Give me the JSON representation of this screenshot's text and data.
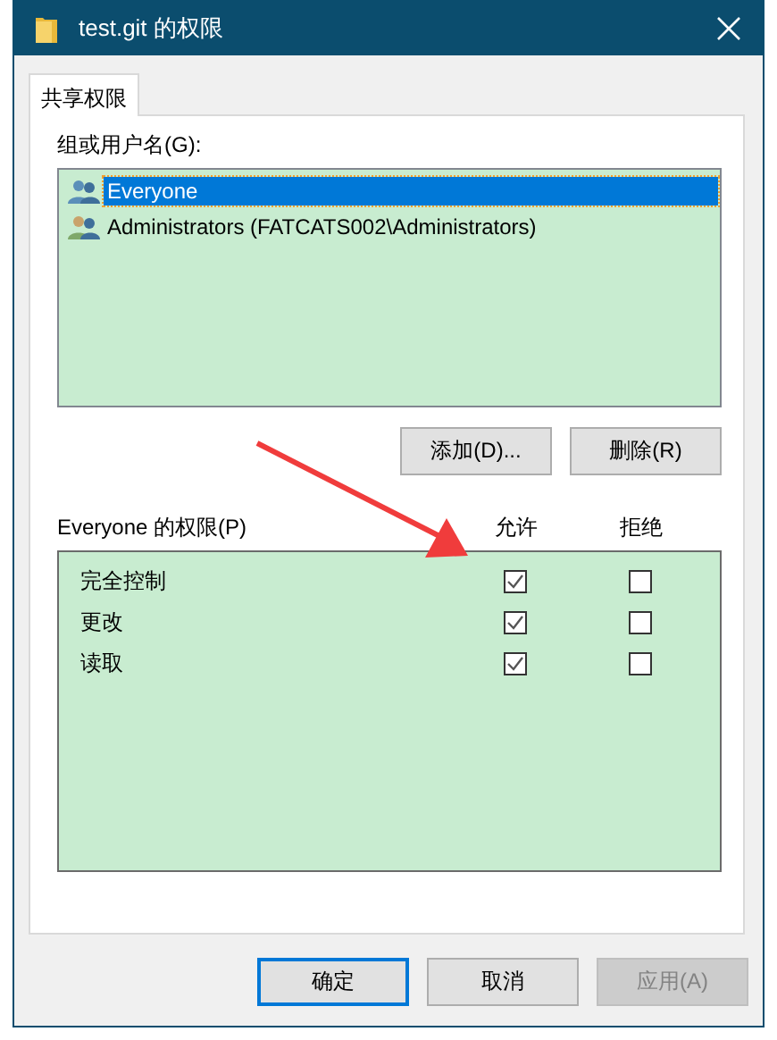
{
  "window": {
    "title": "test.git 的权限"
  },
  "tabs": [
    {
      "label": "共享权限",
      "selected": true
    }
  ],
  "users": {
    "label": "组或用户名(G):",
    "items": [
      {
        "name": "Everyone",
        "selected": true
      },
      {
        "name": "Administrators (FATCATS002\\Administrators)",
        "selected": false
      }
    ],
    "buttons": [
      {
        "label": "添加(D)..."
      },
      {
        "label": "删除(R)"
      }
    ]
  },
  "permissions": {
    "label": "Everyone 的权限(P)",
    "columns": [
      "允许",
      "拒绝"
    ],
    "rows": [
      {
        "name": "完全控制",
        "allow": true,
        "deny": false
      },
      {
        "name": "更改",
        "allow": true,
        "deny": false
      },
      {
        "name": "读取",
        "allow": true,
        "deny": false
      }
    ]
  },
  "buttons": [
    {
      "label": "确定",
      "focused": true,
      "disabled": false
    },
    {
      "label": "取消",
      "focused": false,
      "disabled": false
    },
    {
      "label": "应用(A)",
      "focused": false,
      "disabled": true
    }
  ]
}
